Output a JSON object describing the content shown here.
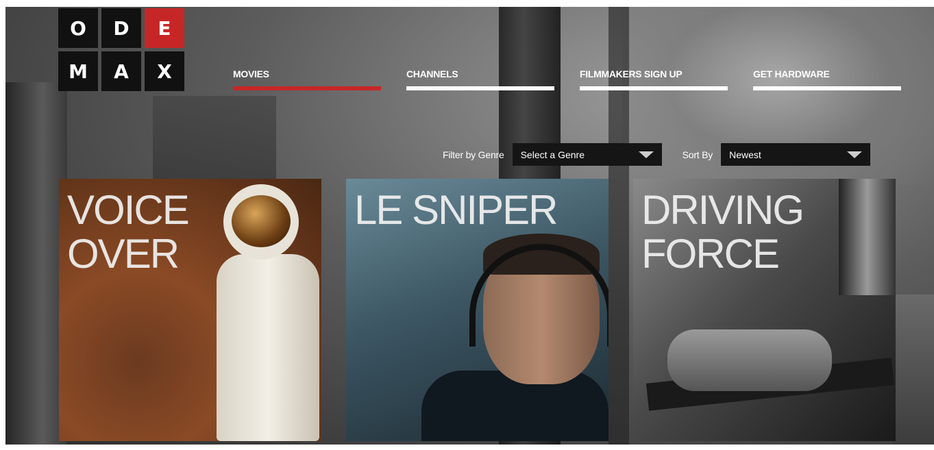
{
  "logo": {
    "letters": [
      "O",
      "D",
      "E",
      "M",
      "A",
      "X"
    ]
  },
  "nav": {
    "items": [
      {
        "label": "MOVIES",
        "active": true
      },
      {
        "label": "CHANNELS",
        "active": false
      },
      {
        "label": "FILMMAKERS SIGN UP",
        "active": false
      },
      {
        "label": "GET HARDWARE",
        "active": false
      }
    ]
  },
  "filters": {
    "genre_label": "Filter by Genre",
    "genre_value": "Select a Genre",
    "sort_label": "Sort By",
    "sort_value": "Newest"
  },
  "movies": [
    {
      "title": "VOICE\nOVER"
    },
    {
      "title": "LE SNIPER"
    },
    {
      "title": "DRIVING\nFORCE"
    }
  ],
  "colors": {
    "accent": "#c62726",
    "nav_bar": "#ffffff",
    "select_bg": "#151515"
  },
  "icons": {
    "dropdown": "caret-down-icon"
  }
}
